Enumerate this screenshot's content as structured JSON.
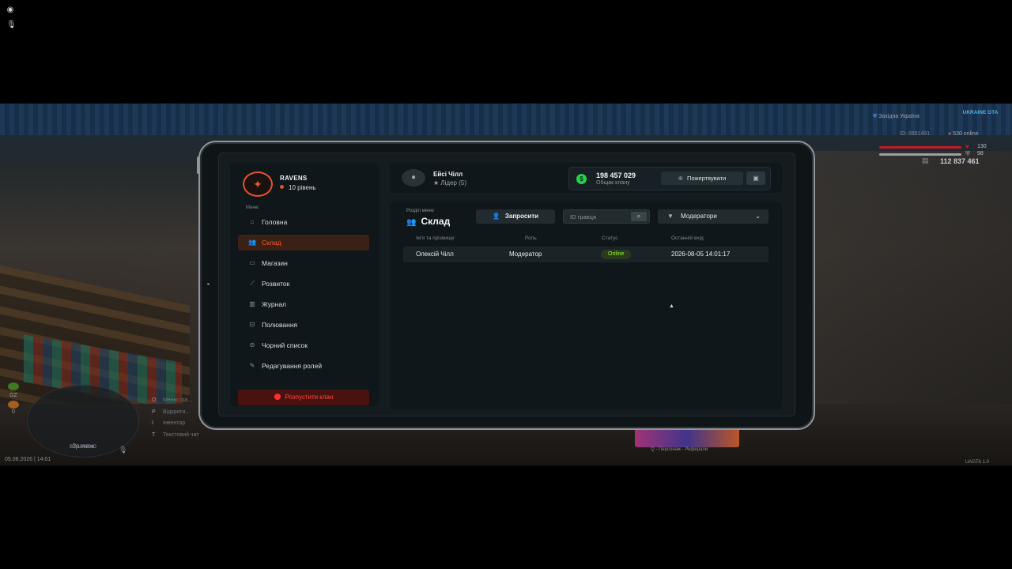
{
  "overlay_icons": {
    "top": "record-icon",
    "bottom": "mic-icon"
  },
  "hud": {
    "region": "Західна Україна",
    "server_logo": "UKRAINE GTA",
    "player_id": "ID: 6891491",
    "online": "530 online",
    "health": "130",
    "armor": "98",
    "cash": "112 837 461",
    "health_color": "#c21d2a",
    "armor_color": "#9aa1a6"
  },
  "minimap": {
    "line1": "За язок",
    "line2": "втрачено"
  },
  "status_indicators": [
    "GZ",
    "0"
  ],
  "hotkeys": [
    {
      "key": "O",
      "label": "Меню гра..."
    },
    {
      "key": "P",
      "label": "Відкрити..."
    },
    {
      "key": "I",
      "label": "Інвентар"
    },
    {
      "key": "T",
      "label": "Текстовий чат"
    }
  ],
  "datetime": "05.08.2026 | 14:01",
  "version": "UAGTA 1.0",
  "promo_footer": "Q - Персонаж - Реферали",
  "sidebar": {
    "clan_name": "RAVENS",
    "clan_level": "10 рівень",
    "menu_title": "Меню",
    "items": [
      {
        "label": "Головна",
        "icon": "home-icon",
        "active": false
      },
      {
        "label": "Склад",
        "icon": "users-icon",
        "active": true
      },
      {
        "label": "Магазин",
        "icon": "shop-icon",
        "active": false
      },
      {
        "label": "Розвиток",
        "icon": "chart-icon",
        "active": false
      },
      {
        "label": "Журнал",
        "icon": "book-icon",
        "active": false
      },
      {
        "label": "Полювання",
        "icon": "target-icon",
        "active": false
      },
      {
        "label": "Чорний список",
        "icon": "blacklist-icon",
        "active": false
      },
      {
        "label": "Редагування ролей",
        "icon": "user-edit-icon",
        "active": false
      }
    ],
    "disband_label": "Розпустити клан",
    "accent_color": "#ff5a2a"
  },
  "header": {
    "user_name": "Ейсі Чілл",
    "user_role": "Лідер (5)",
    "treasury_amount": "198 457 029",
    "treasury_label": "Общак клану",
    "donate_label": "Пожертвувати"
  },
  "content": {
    "section_caption": "Розділ меню",
    "section_title": "Склад",
    "invite_label": "Запросити",
    "search_placeholder": "ID гравця",
    "filter_value": "Модератори",
    "columns": [
      "Ім'я та прізвище",
      "Роль",
      "Статус",
      "Останній вхід"
    ],
    "rows": [
      {
        "name": "Олексій Чілл",
        "role": "Модератор",
        "status": "Online",
        "last_login": "2026-08-05 14:01:17"
      }
    ],
    "status_online_color": "#9cff2e"
  }
}
